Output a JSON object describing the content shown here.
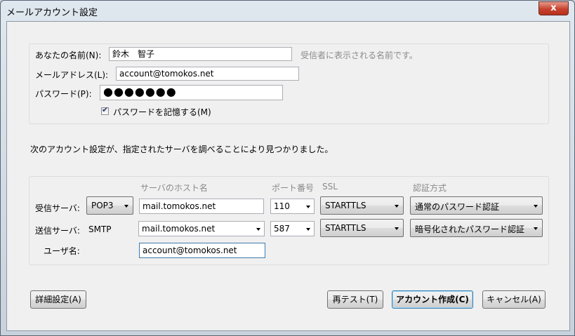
{
  "window": {
    "title": "メールアカウント設定",
    "close_label": "x"
  },
  "identity": {
    "name_label": "あなたの名前(N):",
    "name_value": "鈴木　智子",
    "name_hint": "受信者に表示される名前です。",
    "email_label": "メールアドレス(L):",
    "email_value": "account@tomokos.net",
    "password_label": "パスワード(P):",
    "password_value": "●●●●●●●",
    "remember_label": "パスワードを記憶する(M)",
    "remember_checked": true
  },
  "message": "次のアカウント設定が、指定されたサーバを調べることにより見つかりました。",
  "servers": {
    "headers": {
      "host": "サーバのホスト名",
      "port": "ポート番号",
      "ssl": "SSL",
      "auth": "認証方式"
    },
    "incoming": {
      "label": "受信サーバ:",
      "protocol": "POP3",
      "host": "mail.tomokos.net",
      "port": "110",
      "ssl": "STARTTLS",
      "auth": "通常のパスワード認証"
    },
    "outgoing": {
      "label": "送信サーバ:",
      "protocol": "SMTP",
      "host": "mail.tomokos.net",
      "port": "587",
      "ssl": "STARTTLS",
      "auth": "暗号化されたパスワード認証"
    },
    "username_label": "ユーザ名:",
    "username_value": "account@tomokos.net"
  },
  "buttons": {
    "advanced": "詳細設定(A)",
    "retest": "再テスト(T)",
    "create": "アカウント作成(C)",
    "cancel": "キャンセル(A)"
  }
}
